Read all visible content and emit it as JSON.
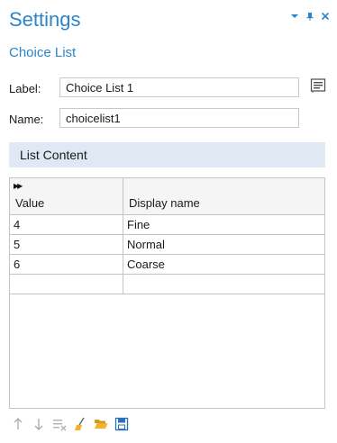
{
  "panel": {
    "title": "Settings",
    "subtitle": "Choice List",
    "window_controls": [
      "chevron-down-icon",
      "pin-icon",
      "close-icon"
    ]
  },
  "fields": {
    "label": {
      "caption": "Label:",
      "value": "Choice List 1"
    },
    "name": {
      "caption": "Name:",
      "value": "choicelist1"
    }
  },
  "section": {
    "title": "List Content"
  },
  "table": {
    "headers": {
      "value": "Value",
      "display": "Display name"
    },
    "rows": [
      {
        "value": "4",
        "display": "Fine"
      },
      {
        "value": "5",
        "display": "Normal"
      },
      {
        "value": "6",
        "display": "Coarse"
      },
      {
        "value": "",
        "display": ""
      }
    ]
  },
  "toolbar": {
    "icons": [
      "move-up-icon",
      "move-down-icon",
      "delete-icon",
      "clear-table-icon",
      "load-from-file-icon",
      "save-to-file-icon"
    ]
  },
  "colors": {
    "accent": "#2c84c9",
    "section_bg": "#dfe8f3",
    "border": "#c4c4c4"
  }
}
